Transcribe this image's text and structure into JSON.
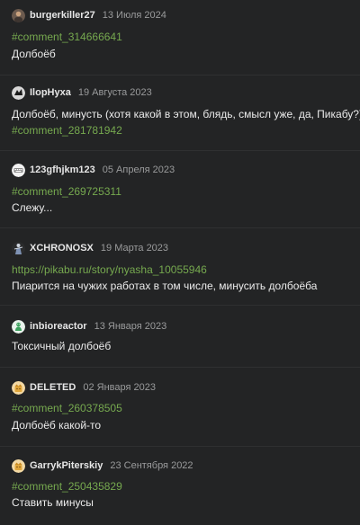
{
  "comments": [
    {
      "username": "burgerkiller27",
      "date": "13 Июля 2024",
      "avatar_icon": "user-photo-icon",
      "link": "#comment_314666641",
      "text": "Долбоёб"
    },
    {
      "username": "IlopHyxa",
      "date": "19 Августа 2023",
      "avatar_icon": "black-bird-icon",
      "text": "Долбоёб, минусть (хотя какой в этом, блядь, смысл уже, да, Пикабу?)",
      "link": "#comment_281781942"
    },
    {
      "username": "123gfhjkm123",
      "date": "05 Апреля 2023",
      "avatar_icon": "keyboard-icon",
      "link": "#comment_269725311",
      "text": "Слежу..."
    },
    {
      "username": "XCHRONOSX",
      "date": "19 Марта 2023",
      "avatar_icon": "figure-icon",
      "link": "https://pikabu.ru/story/nyasha_10055946",
      "text": "Пиарится на чужих работах в том числе, минусить долбоёба"
    },
    {
      "username": "inbioreactor",
      "date": "13 Января 2023",
      "avatar_icon": "green-creature-icon",
      "text": "Токсичный долбоёб"
    },
    {
      "username": "DELETED",
      "date": "02 Января 2023",
      "avatar_icon": "default-avatar-icon",
      "link": "#comment_260378505",
      "text": "Долбоёб какой-то"
    },
    {
      "username": "GarrykPiterskiy",
      "date": "23 Сентября 2022",
      "avatar_icon": "default-avatar-icon",
      "link": "#comment_250435829",
      "text": "Ставить минусы"
    }
  ],
  "colors": {
    "background": "#232425",
    "link": "#76a94f",
    "text": "#ebebeb",
    "date": "#9a9b9c"
  }
}
